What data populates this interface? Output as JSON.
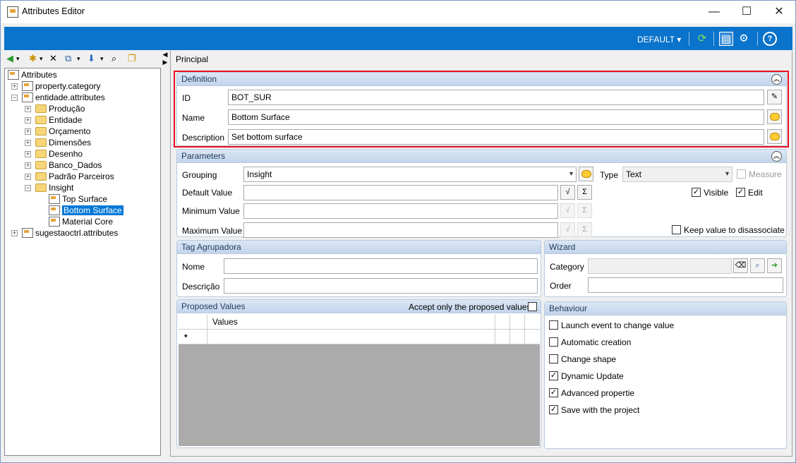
{
  "window": {
    "title": "Attributes Editor",
    "minimize": "—",
    "maximize": "☐",
    "close": "✕"
  },
  "topbar": {
    "profile": "DEFAULT",
    "profile_arrow": "▾",
    "refresh_icon": "refresh-icon",
    "view_icon": "view-icon",
    "settings_icon": "settings-icon",
    "help_icon": "help-icon",
    "accent": "#0a73cb"
  },
  "tree": {
    "root": "Attributes",
    "items": [
      {
        "label": "property.category"
      },
      {
        "label": "entidade.attributes"
      },
      {
        "label": "Produção"
      },
      {
        "label": "Entidade"
      },
      {
        "label": "Orçamento"
      },
      {
        "label": "Dimensões"
      },
      {
        "label": "Desenho"
      },
      {
        "label": "Banco_Dados"
      },
      {
        "label": "Padrão Parceiros"
      },
      {
        "label": "Insight"
      },
      {
        "label": "Top Surface"
      },
      {
        "label": "Bottom Surface"
      },
      {
        "label": "Material Core"
      },
      {
        "label": "sugestaoctrl.attributes"
      }
    ]
  },
  "tab": "Principal",
  "definition": {
    "header": "Definition",
    "id_label": "ID",
    "id_value": "BOT_SUR",
    "name_label": "Name",
    "name_value": "Bottom Surface",
    "desc_label": "Description",
    "desc_value": "Set bottom surface"
  },
  "parameters": {
    "header": "Parameters",
    "grouping_label": "Grouping",
    "grouping_value": "Insight",
    "type_label": "Type",
    "type_value": "Text",
    "measure_label": "Measure",
    "default_label": "Default Value",
    "min_label": "Minimum Value",
    "max_label": "Maximum Value",
    "visible_label": "Visible",
    "edit_label": "Edit",
    "keep_label": "Keep value to disassociate",
    "sigma": "Σ"
  },
  "tag": {
    "header": "Tag Agrupadora",
    "name_label": "Nome",
    "desc_label": "Descrição"
  },
  "wizard": {
    "header": "Wizard",
    "category_label": "Category",
    "order_label": "Order"
  },
  "proposed": {
    "header": "Proposed Values",
    "accept_label": "Accept only the proposed values",
    "col_values": "Values",
    "new_row_marker": "*"
  },
  "behaviour": {
    "header": "Behaviour",
    "items": [
      {
        "label": "Launch event to change value",
        "checked": false
      },
      {
        "label": "Automatic creation",
        "checked": false
      },
      {
        "label": "Change shape",
        "checked": false
      },
      {
        "label": "Dynamic Update",
        "checked": true
      },
      {
        "label": "Advanced propertie",
        "checked": true
      },
      {
        "label": "Save with the project",
        "checked": true
      }
    ]
  }
}
